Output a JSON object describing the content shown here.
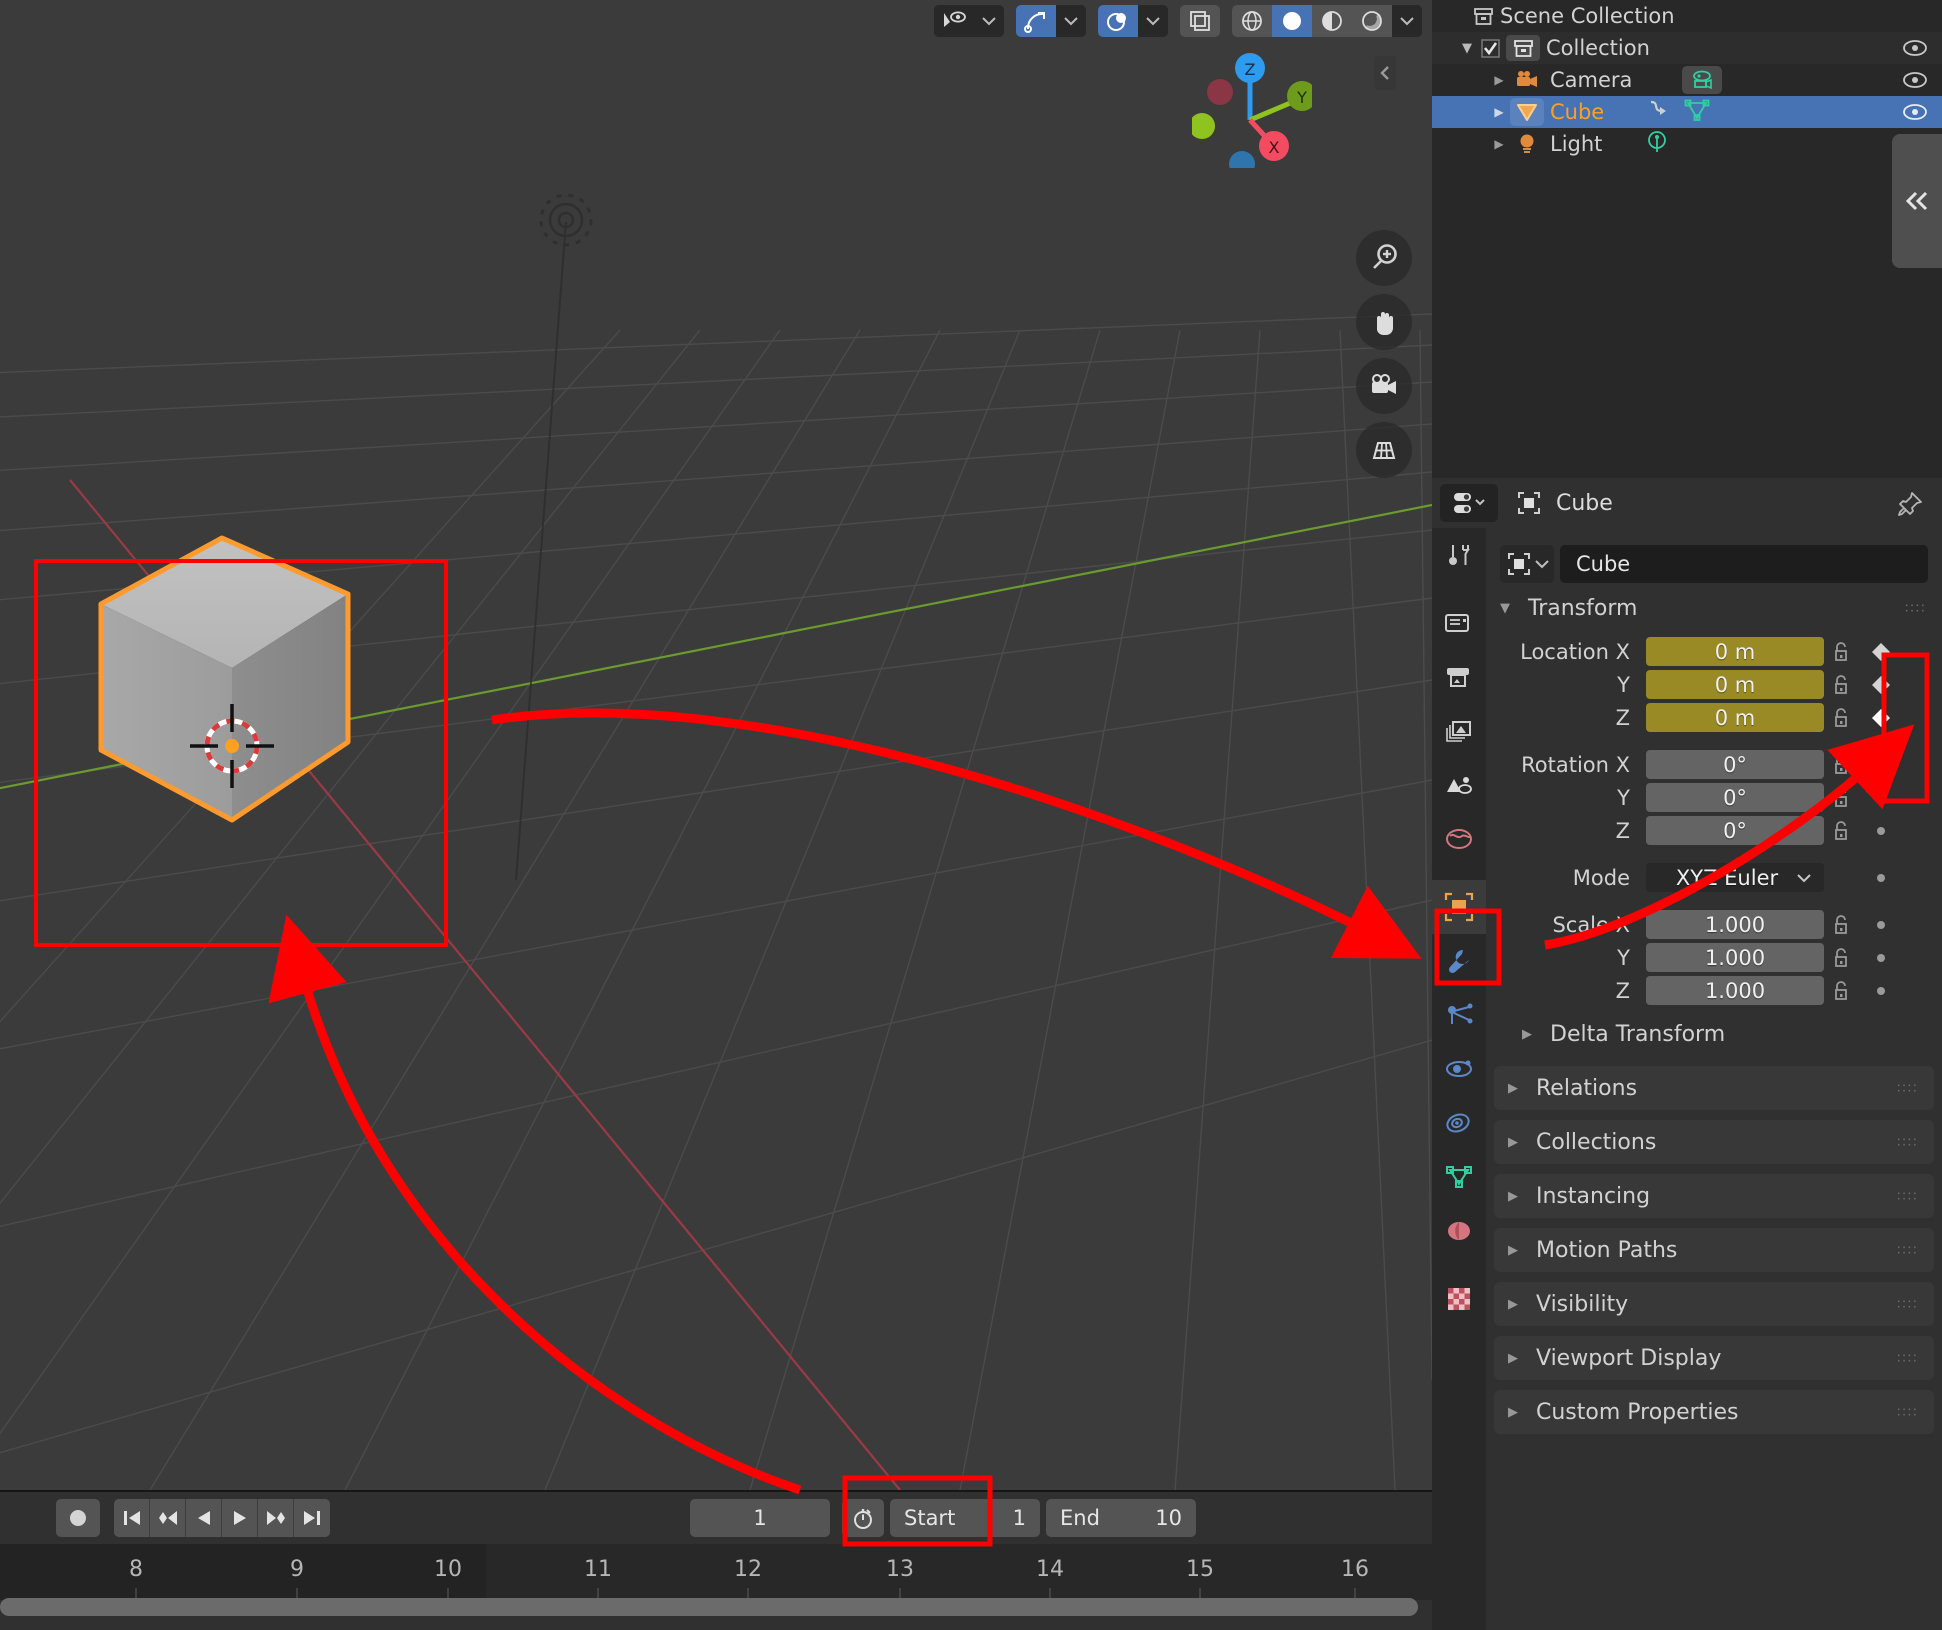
{
  "viewport": {
    "header_icons": [
      {
        "name": "object-visibility-icon",
        "state": "off"
      },
      {
        "name": "chevron-down-icon",
        "state": "off"
      },
      {
        "name": "snap-magnet-icon",
        "state": "on"
      },
      {
        "name": "chevron-down-icon",
        "state": "off"
      },
      {
        "name": "proportional-editing-icon",
        "state": "on"
      },
      {
        "name": "chevron-down-icon",
        "state": "off"
      },
      {
        "name": "toggle-xray-icon",
        "state": "grey"
      },
      {
        "name": "shading-wireframe-icon",
        "state": "grey"
      },
      {
        "name": "shading-solid-icon",
        "state": "on"
      },
      {
        "name": "shading-material-preview-icon",
        "state": "grey"
      },
      {
        "name": "shading-rendered-icon",
        "state": "grey"
      },
      {
        "name": "chevron-down-icon",
        "state": "off"
      }
    ],
    "gizmo_axes": [
      "Z",
      "Y",
      "X"
    ],
    "tools": [
      "zoom-icon",
      "hand-pan-icon",
      "camera-view-icon",
      "toggle-orthographic-icon"
    ],
    "cursor_label": "3d-cursor",
    "selected_object": "Cube"
  },
  "timeline": {
    "record_label": "●",
    "transport": [
      "jump-to-start-icon",
      "jump-to-prev-keyframe-icon",
      "play-reverse-icon",
      "play-icon",
      "jump-to-next-keyframe-icon",
      "jump-to-end-icon"
    ],
    "current_frame": "1",
    "start_label": "Start",
    "start_value": "1",
    "end_label": "End",
    "end_value": "10",
    "ruler_ticks": [
      "8",
      "9",
      "10",
      "11",
      "12",
      "13",
      "14",
      "15",
      "16"
    ],
    "auto_key_icon": "stopwatch-icon"
  },
  "outliner": {
    "rows": [
      {
        "label": "Scene Collection",
        "icon": "collection-icon",
        "indent": 0,
        "selected": false,
        "eye": false,
        "disclosure": ""
      },
      {
        "label": "Collection",
        "icon": "collection-icon",
        "indent": 1,
        "selected": false,
        "eye": true,
        "disclosure": "▼",
        "checkbox": true
      },
      {
        "label": "Camera",
        "icon": "camera-data-icon",
        "indent": 2,
        "selected": false,
        "eye": true,
        "disclosure": "▶",
        "extra": "camera-data-green-icon"
      },
      {
        "label": "Cube",
        "icon": "mesh-object-icon",
        "indent": 2,
        "selected": true,
        "eye": true,
        "disclosure": "▶",
        "extra": "modifier-icon, mesh-data-icon"
      },
      {
        "label": "Light",
        "icon": "light-object-icon",
        "indent": 2,
        "selected": false,
        "eye": true,
        "disclosure": "▶",
        "extra": "light-data-green-icon"
      }
    ],
    "collapse_icon": "double-chevron-left-icon"
  },
  "properties": {
    "breadcrumb_icon": "object-properties-icon",
    "breadcrumb": "Cube",
    "pin_icon": "pin-icon",
    "editor_type_icon": "properties-editor-icon",
    "id_name": "Cube",
    "tabs": [
      {
        "name": "tool-tab",
        "active": false
      },
      {
        "name": "render-tab",
        "active": false
      },
      {
        "name": "output-tab",
        "active": false
      },
      {
        "name": "view-layer-tab",
        "active": false
      },
      {
        "name": "scene-tab",
        "active": false
      },
      {
        "name": "world-tab",
        "active": false
      },
      {
        "name": "object-tab",
        "active": true
      },
      {
        "name": "modifier-tab",
        "active": false
      },
      {
        "name": "particles-tab",
        "active": false
      },
      {
        "name": "physics-tab",
        "active": false
      },
      {
        "name": "object-constraints-tab",
        "active": false
      },
      {
        "name": "object-data-tab",
        "active": false
      },
      {
        "name": "material-tab",
        "active": false
      },
      {
        "name": "texture-tab",
        "active": false
      }
    ],
    "transform": {
      "title": "Transform",
      "rows": [
        {
          "label": "Location X",
          "value": "0 m",
          "style": "anim",
          "key": "diamond-filled"
        },
        {
          "label": "Y",
          "value": "0 m",
          "style": "anim",
          "key": "diamond-filled"
        },
        {
          "label": "Z",
          "value": "0 m",
          "style": "anim",
          "key": "diamond-bright"
        },
        {
          "label": "Rotation X",
          "value": "0°",
          "style": "norm",
          "key": "dot"
        },
        {
          "label": "Y",
          "value": "0°",
          "style": "norm",
          "key": "dot"
        },
        {
          "label": "Z",
          "value": "0°",
          "style": "norm",
          "key": "dot"
        },
        {
          "label": "Mode",
          "value": "XYZ Euler",
          "style": "dd",
          "key": "dot"
        },
        {
          "label": "Scale X",
          "value": "1.000",
          "style": "norm",
          "key": "dot"
        },
        {
          "label": "Y",
          "value": "1.000",
          "style": "norm",
          "key": "dot"
        },
        {
          "label": "Z",
          "value": "1.000",
          "style": "norm",
          "key": "dot"
        }
      ],
      "delta_label": "Delta Transform"
    },
    "panels": [
      "Relations",
      "Collections",
      "Instancing",
      "Motion Paths",
      "Visibility",
      "Viewport Display",
      "Custom Properties"
    ]
  },
  "annotations": {
    "color": "#ff0000",
    "boxes": [
      "cube-highlight-box",
      "object-tab-highlight-box",
      "keyframe-column-highlight-box",
      "current-frame-highlight-box"
    ],
    "arrows": [
      "arrow-to-object-tab",
      "arrow-to-keyframe-buttons",
      "arrow-to-cube"
    ]
  },
  "colors": {
    "accent_blue": "#4772b3",
    "anim_yellow": "#9a8a26",
    "select_orange": "#ffa023",
    "annotation_red": "#ff0000",
    "viewport_bg": "#3b3b3b"
  }
}
